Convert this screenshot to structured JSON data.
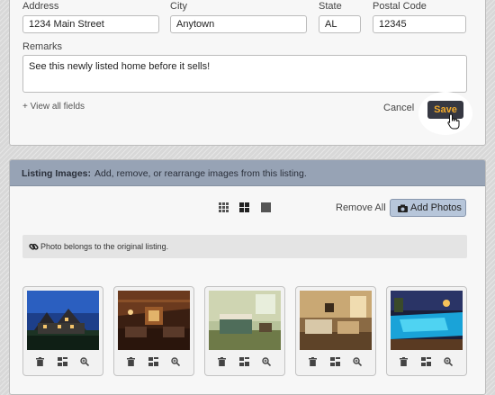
{
  "form": {
    "address_label": "Address",
    "address_value": "1234 Main Street",
    "city_label": "City",
    "city_value": "Anytown",
    "state_label": "State",
    "state_value": "AL",
    "postal_label": "Postal Code",
    "postal_value": "12345",
    "remarks_label": "Remarks",
    "remarks_value": "See this newly listed home before it sells!",
    "view_all_label": "+ View all fields",
    "cancel_label": "Cancel",
    "save_label": "Save"
  },
  "listing_images": {
    "title": "Listing Images:",
    "description": "Add, remove, or rearrange images from this listing.",
    "view_modes": [
      "small-grid-icon",
      "medium-grid-icon",
      "large-view-icon"
    ],
    "remove_all_label": "Remove All",
    "add_photos_label": "Add Photos",
    "notice_text": "Photo belongs to the original listing.",
    "photos": [
      {
        "subject": "house exterior at dusk"
      },
      {
        "subject": "living room with wooden beams"
      },
      {
        "subject": "bedroom"
      },
      {
        "subject": "family room"
      },
      {
        "subject": "pool at night"
      }
    ],
    "photo_actions": [
      "trash-icon",
      "reorder-icon",
      "zoom-in-icon"
    ]
  },
  "colors": {
    "save_bg": "#363842",
    "save_text": "#f0a92b",
    "header_bg": "#97a3b5",
    "add_photos_bg": "#b7c6da"
  }
}
